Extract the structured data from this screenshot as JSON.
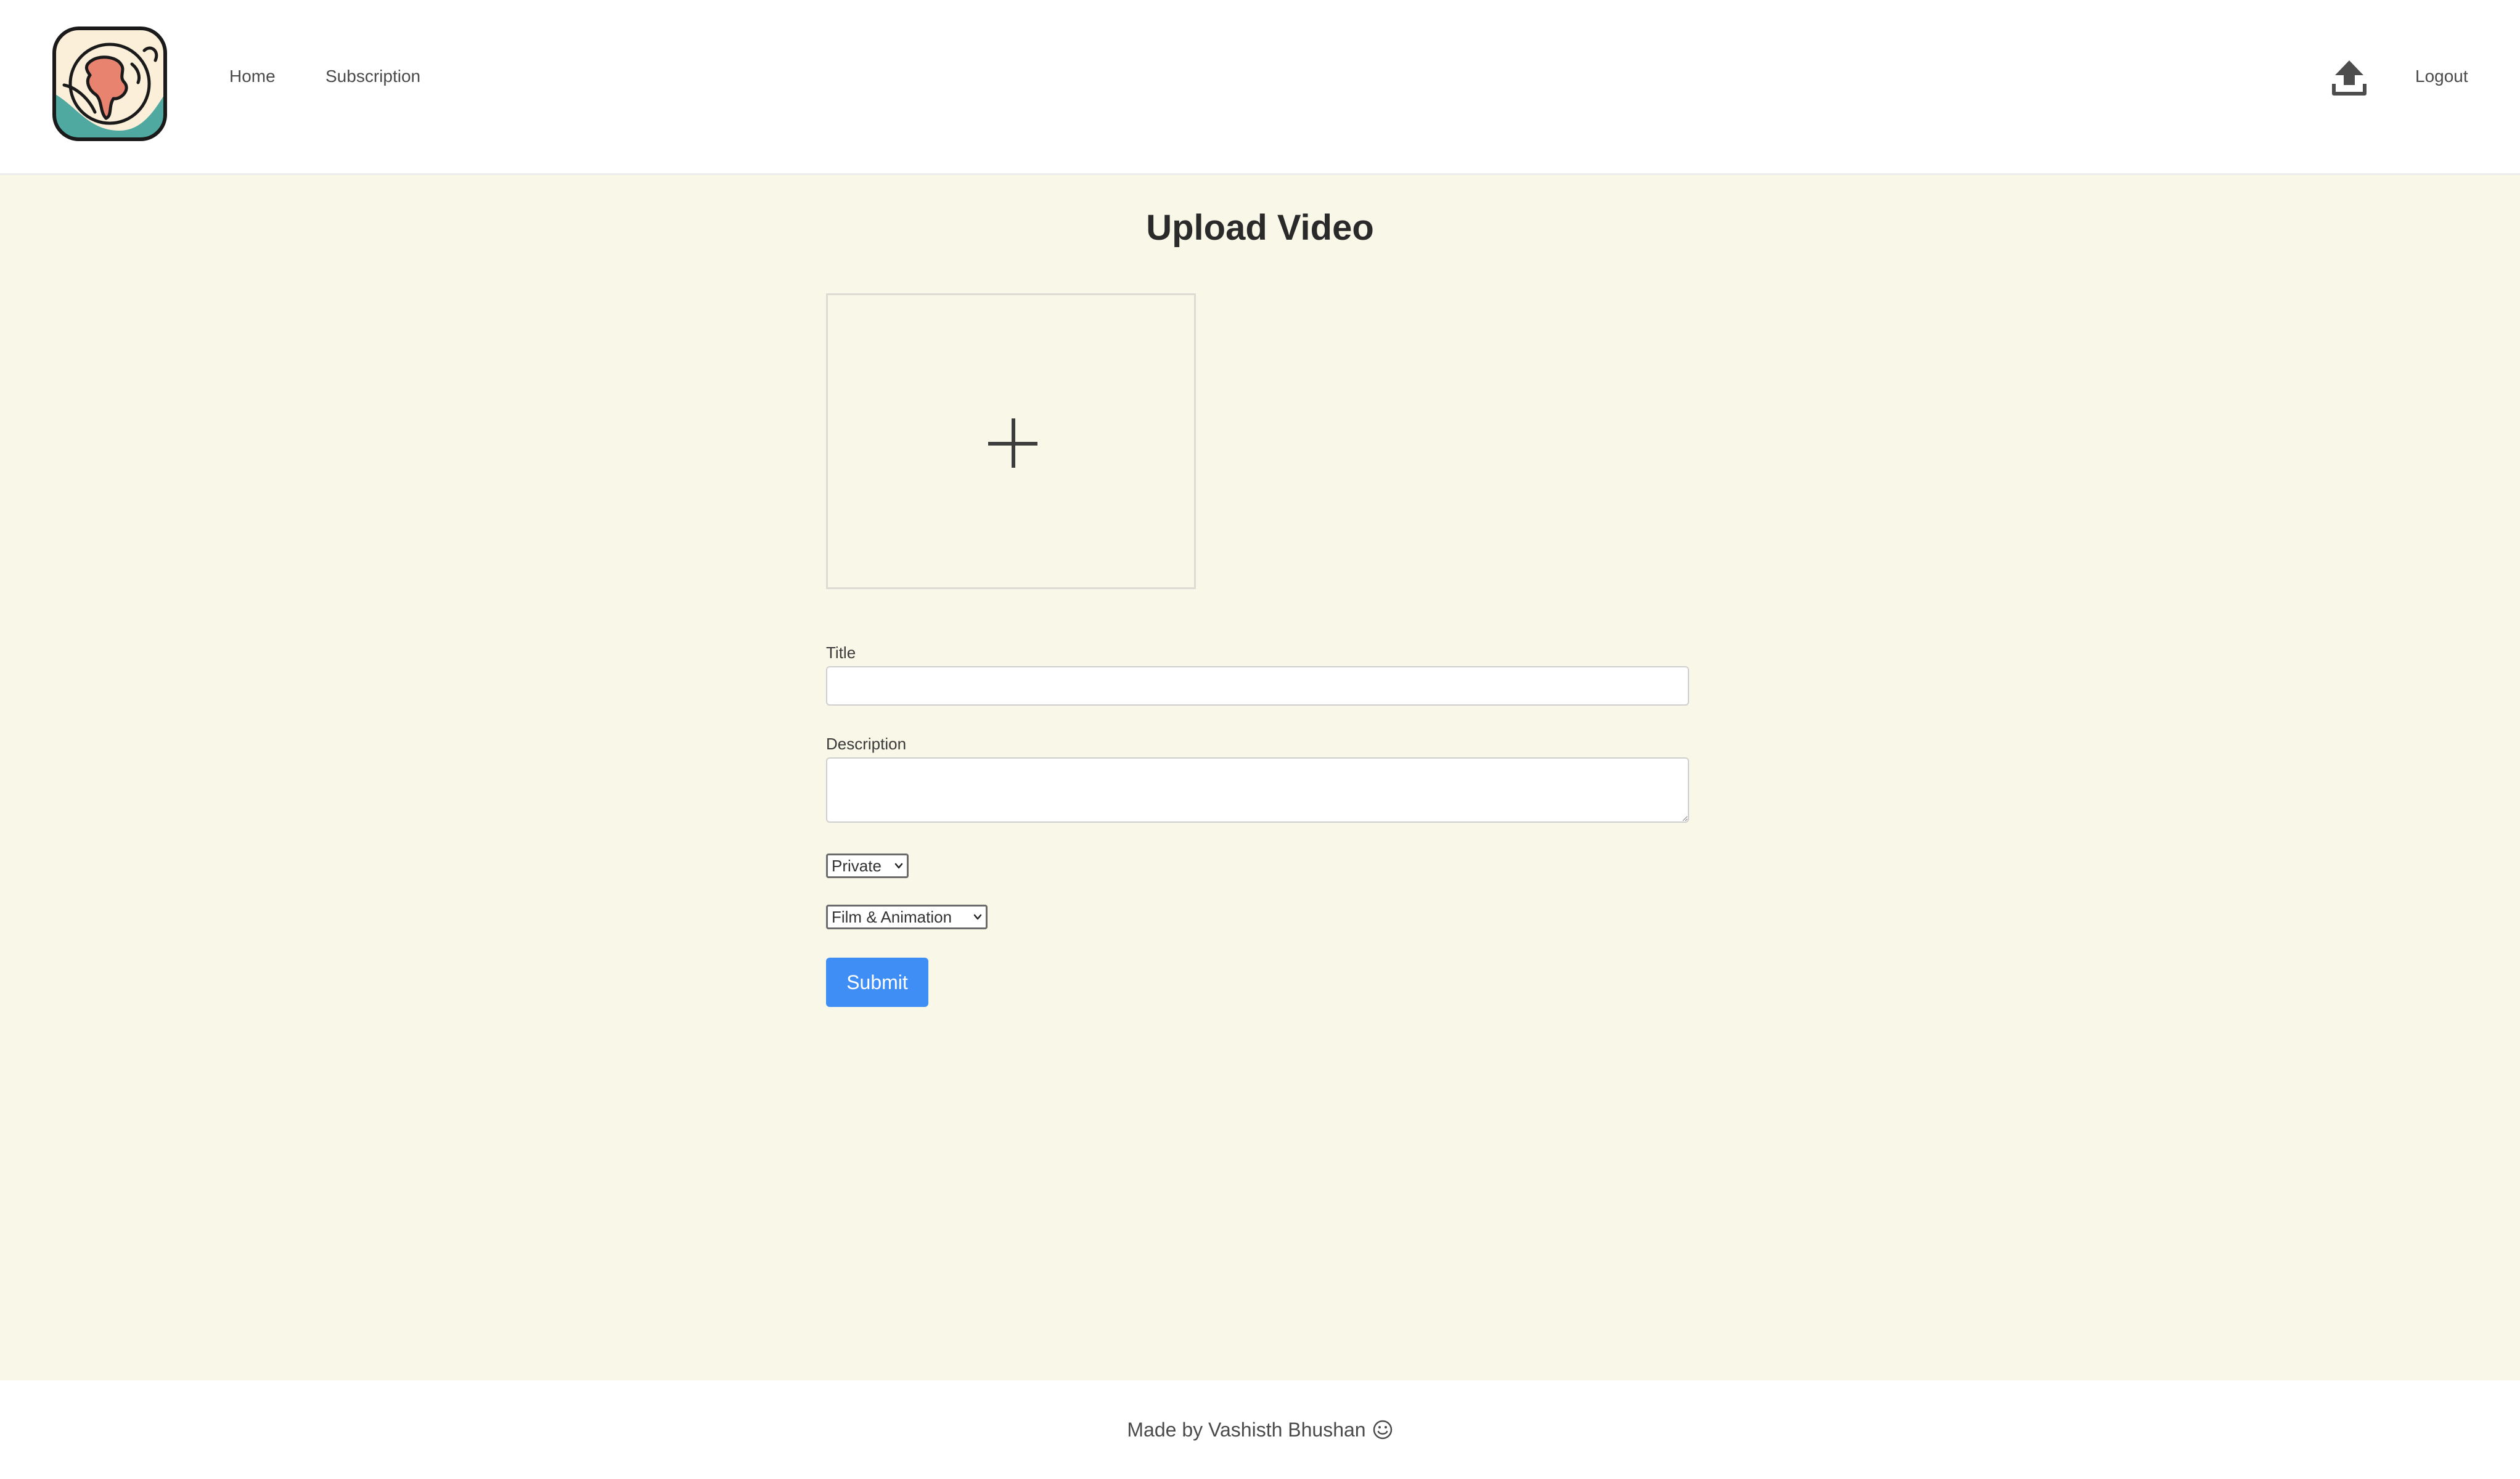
{
  "header": {
    "nav": {
      "home_label": "Home",
      "subscription_label": "Subscription",
      "logout_label": "Logout"
    },
    "icons": {
      "logo": "globe-logo-icon",
      "upload": "upload-icon"
    }
  },
  "main": {
    "title": "Upload Video",
    "dropzone_icon": "plus-icon",
    "fields": {
      "title_label": "Title",
      "title_value": "",
      "description_label": "Description",
      "description_value": ""
    },
    "visibility_select": {
      "selected": "Private"
    },
    "category_select": {
      "selected": "Film & Animation"
    },
    "submit_label": "Submit"
  },
  "footer": {
    "credit": "Made by Vashisth Bhushan",
    "icon": "smile-icon"
  },
  "colors": {
    "main_background": "#f9f8e8",
    "accent": "#3e8ef5",
    "logo_teal": "#4fa9a0",
    "logo_salmon": "#e8836f"
  }
}
